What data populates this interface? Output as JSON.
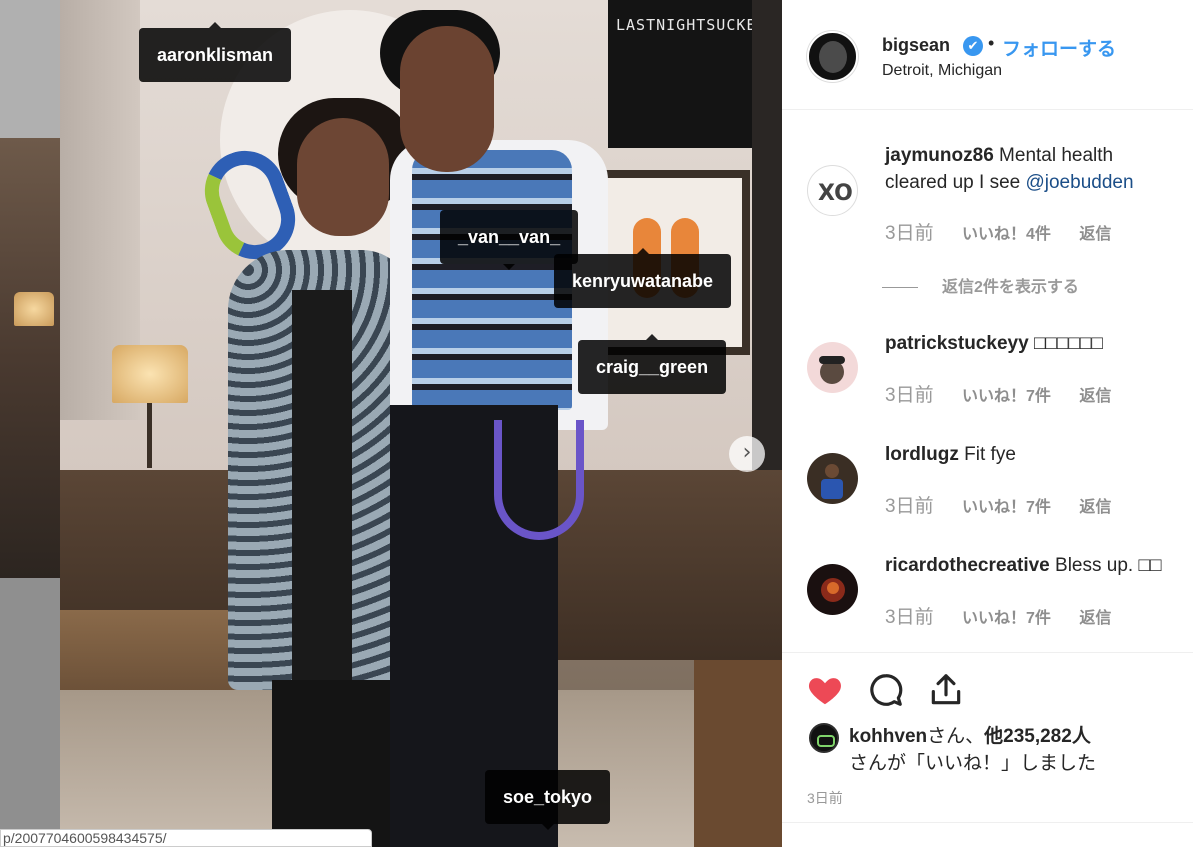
{
  "background": {
    "url_text": "p/2007704600598434575/"
  },
  "photo": {
    "poster_text": "LASTNIGHTSUCKED",
    "tags": [
      {
        "label": "aaronklisman"
      },
      {
        "label": "_van__van_"
      },
      {
        "label": "kenryuwatanabe"
      },
      {
        "label": "craig__green"
      },
      {
        "label": "soe_tokyo"
      }
    ],
    "next_arrow": "›"
  },
  "header": {
    "username": "bigsean",
    "verified_icon": "✔",
    "separator": "•",
    "follow_label": "フォローする",
    "location": "Detroit, Michigan"
  },
  "comments": [
    {
      "username": "jaymunoz86",
      "text": "Mental health cleared up I see",
      "mention": "@joebudden",
      "time": "3日前",
      "likes": "いいね！4件",
      "reply": "返信",
      "view_replies": "返信2件を表示する"
    },
    {
      "username": "patrickstuckeyy",
      "text": "□□□□□□",
      "time": "3日前",
      "likes": "いいね！7件",
      "reply": "返信"
    },
    {
      "username": "lordlugz",
      "text": "Fit fye",
      "time": "3日前",
      "likes": "いいね！7件",
      "reply": "返信"
    },
    {
      "username": "ricardothecreative",
      "text": "Bless up. □□",
      "time": "3日前",
      "likes": "いいね！7件",
      "reply": "返信"
    }
  ],
  "actions": {
    "liker_name": "kohhven",
    "liker_suffix": "さん、",
    "others": "他235,282人",
    "liked_text": "さんが「いいね！」しました",
    "post_time": "3日前"
  },
  "colors": {
    "accent": "#3897f0",
    "heart": "#ed4956",
    "mention": "#1b4e88"
  }
}
